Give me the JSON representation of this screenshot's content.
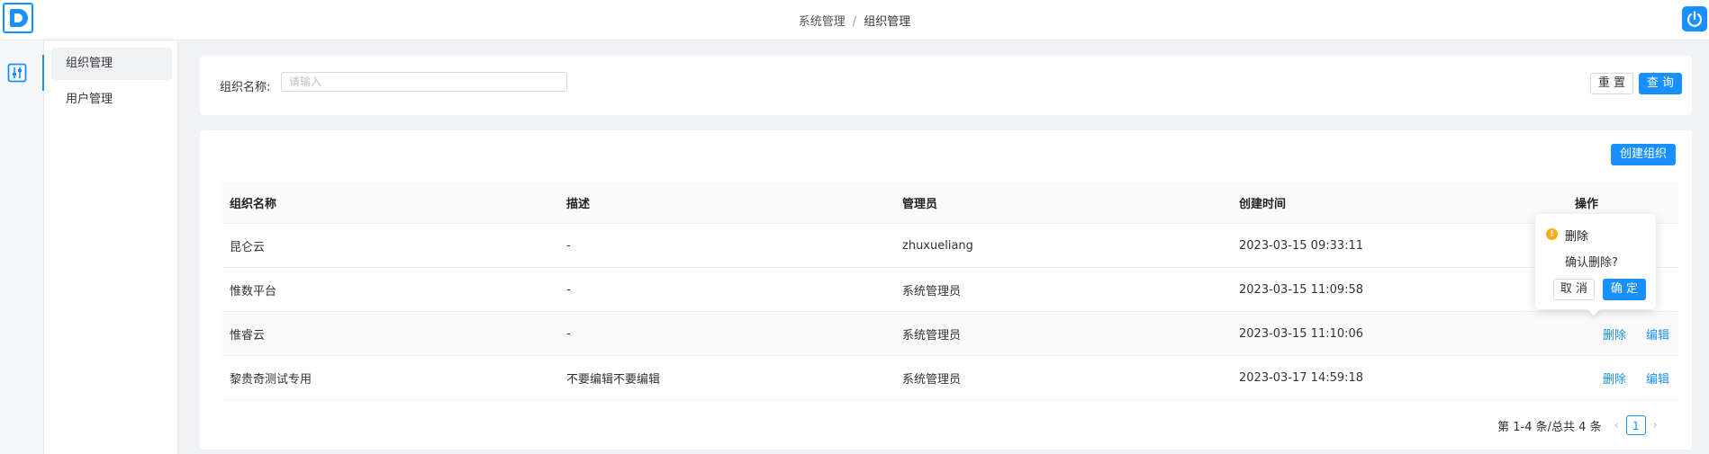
{
  "header": {
    "breadcrumb": [
      "系统管理",
      "组织管理"
    ],
    "breadcrumb_sep": "/"
  },
  "submenu": {
    "items": [
      "组织管理",
      "用户管理"
    ]
  },
  "search": {
    "label": "组织名称:",
    "placeholder": "请输入",
    "reset_label": "重 置",
    "query_label": "查 询"
  },
  "table": {
    "create_label": "创建组织",
    "columns": [
      "组织名称",
      "描述",
      "管理员",
      "创建时间",
      "操作"
    ],
    "rows": [
      {
        "name": "昆仑云",
        "desc": "-",
        "admin": "zhuxueliang",
        "created": "2023-03-15 09:33:11"
      },
      {
        "name": "惟数平台",
        "desc": "-",
        "admin": "系统管理员",
        "created": "2023-03-15 11:09:58"
      },
      {
        "name": "惟睿云",
        "desc": "-",
        "admin": "系统管理员",
        "created": "2023-03-15 11:10:06",
        "delete": "删除",
        "edit": "编辑"
      },
      {
        "name": "黎贵奇测试专用",
        "desc": "不要编辑不要编辑",
        "admin": "系统管理员",
        "created": "2023-03-17 14:59:18",
        "delete": "删除",
        "edit": "编辑"
      }
    ]
  },
  "pagination": {
    "summary": "第 1-4 条/总共 4 条",
    "current": "1",
    "prev": "‹",
    "next": "›"
  },
  "popconfirm": {
    "title": "删除",
    "message": "确认删除?",
    "cancel_label": "取 消",
    "ok_label": "确 定"
  },
  "colors": {
    "primary": "#1890ff",
    "warning": "#faad14"
  }
}
